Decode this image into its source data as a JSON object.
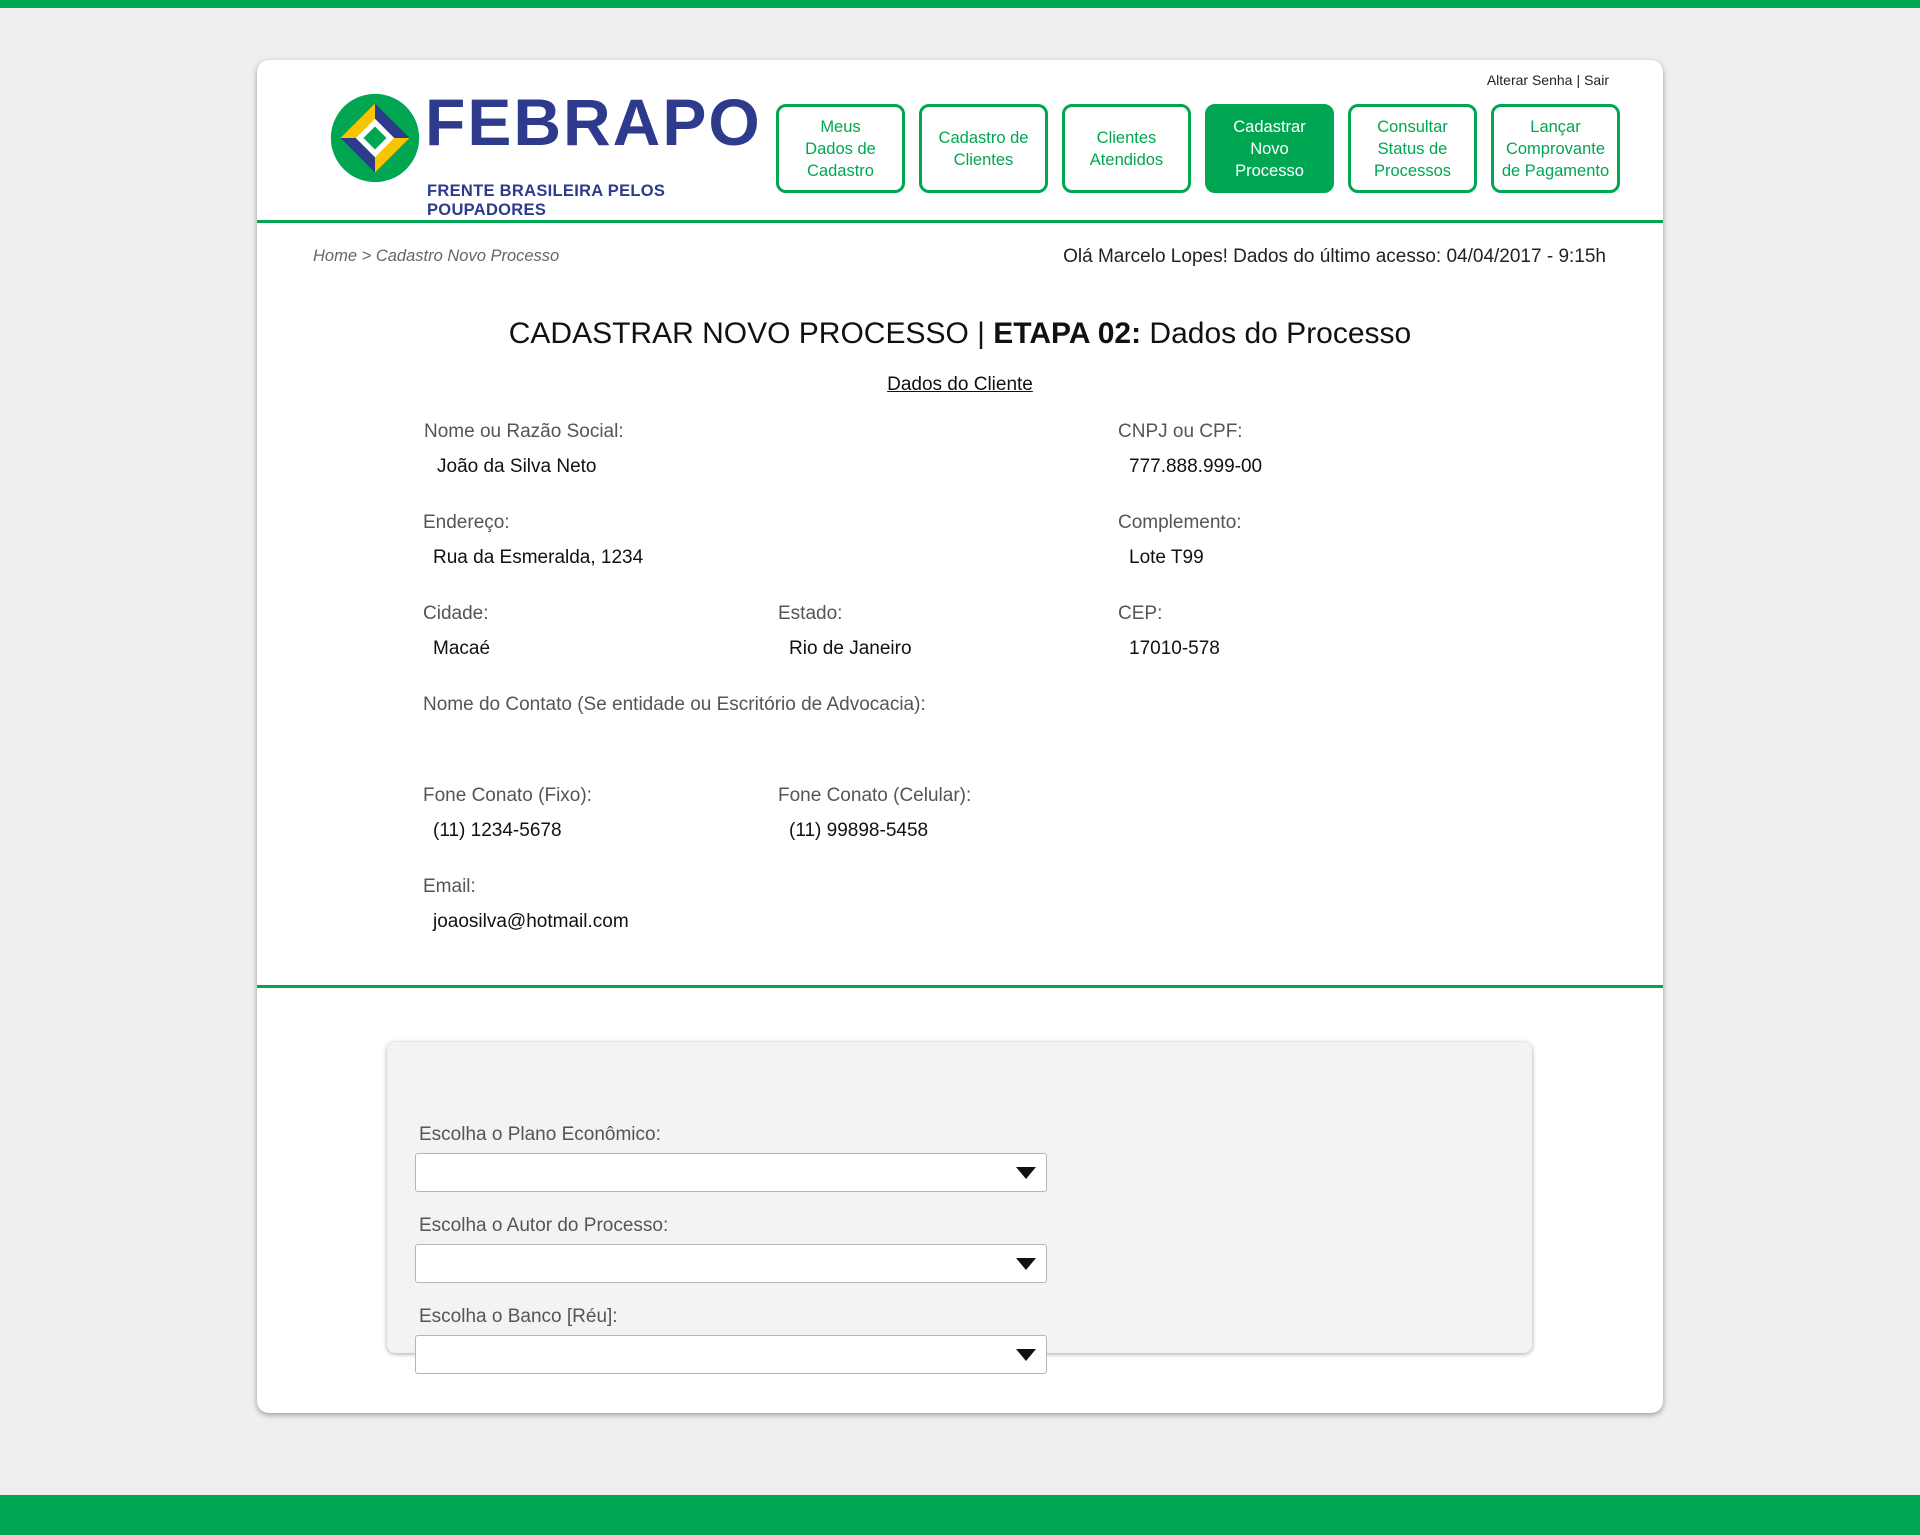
{
  "brand": {
    "title": "FEBRAPO",
    "subtitle": "FRENTE BRASILEIRA PELOS POUPADORES",
    "colors": {
      "green": "#00a651",
      "blue": "#2e3a8c",
      "yellow": "#f7c600"
    }
  },
  "top_links": {
    "change_password": "Alterar Senha",
    "separator": "|",
    "logout": "Sair"
  },
  "nav": [
    {
      "label": "Meus\nDados de\nCadastro",
      "active": false
    },
    {
      "label": "Cadastro de\nClientes",
      "active": false
    },
    {
      "label": "Clientes\nAtendidos",
      "active": false
    },
    {
      "label": "Cadastrar\nNovo\nProcesso",
      "active": true
    },
    {
      "label": "Consultar\nStatus de\nProcessos",
      "active": false
    },
    {
      "label": "Lançar\nComprovante\nde Pagamento",
      "active": false
    }
  ],
  "breadcrumb": "Home > Cadastro Novo Processo",
  "welcome": "Olá Marcelo Lopes! Dados do último acesso: 04/04/2017 - 9:15h",
  "page_title": {
    "prefix": "CADASTRAR NOVO PROCESSO | ",
    "step": "ETAPA 02:",
    "suffix": " Dados do Processo"
  },
  "section_title": "Dados do Cliente",
  "client": {
    "name_label": "Nome ou Razão Social:",
    "name": "João da Silva Neto",
    "doc_label": "CNPJ ou CPF:",
    "doc": "777.888.999-00",
    "address_label": "Endereço:",
    "address": "Rua da Esmeralda, 1234",
    "complement_label": "Complemento:",
    "complement": "Lote T99",
    "city_label": "Cidade:",
    "city": "Macaé",
    "state_label": "Estado:",
    "state": "Rio de Janeiro",
    "cep_label": "CEP:",
    "cep": "17010-578",
    "contact_label": "Nome do Contato (Se entidade ou Escritório de Advocacia):",
    "phone_fixed_label": "Fone Conato (Fixo):",
    "phone_fixed": "(11) 1234-5678",
    "phone_mobile_label": "Fone Conato (Celular):",
    "phone_mobile": "(11) 99898-5458",
    "email_label": "Email:",
    "email": "joaosilva@hotmail.com"
  },
  "form": {
    "plan_label": "Escolha o Plano Econômico:",
    "author_label": "Escolha o Autor do  Processo:",
    "bank_label": "Escolha o Banco [Réu]:",
    "caret_icon": "caret-down-icon"
  }
}
